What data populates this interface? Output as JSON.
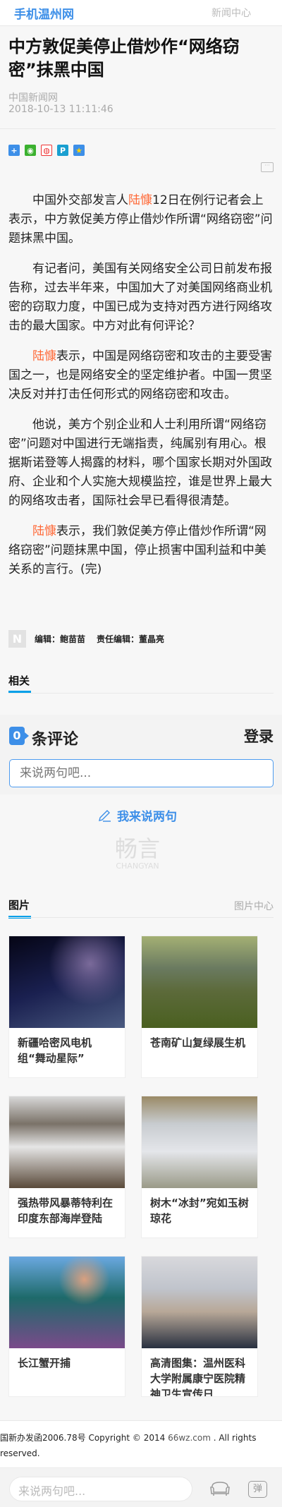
{
  "header": {
    "logo": "手机温州网",
    "nav": "新闻中心"
  },
  "article": {
    "title": "中方敦促美停止借炒作“网络窃密”抹黑中国",
    "source": "中国新闻网",
    "date": "2018-10-13 11:11:46",
    "share_icons": [
      "addthis-icon",
      "wechat-icon",
      "weibo-icon",
      "pengyou-icon",
      "qzone-icon"
    ],
    "highlight_color": "#ff6633",
    "paragraphs": [
      {
        "a": "中国外交部发言人",
        "h": "陆慷",
        "b": "12日在例行记者会上表示，中方敦促美方停止借炒作所谓“网络窃密”问题抹黑中国。"
      },
      {
        "a": "有记者问，美国有关网络安全公司日前发布报告称，过去半年来，中国加大了对美国网络商业机密的窃取力度，中国已成为支持对西方进行网络攻击的最大国家。中方对此有何评论？"
      },
      {
        "h": "陆慷",
        "b": "表示，中国是网络窃密和攻击的主要受害国之一，也是网络安全的坚定维护者。中国一贯坚决反对并打击任何形式的网络窃密和攻击。"
      },
      {
        "a": "他说，美方个别企业和人士利用所谓“网络窃密”问题对中国进行无端指责，纯属别有用心。根据斯诺登等人揭露的材料，哪个国家长期对外国政府、企业和个人实施大规模监控，谁是世界上最大的网络攻击者，国际社会早已看得很清楚。"
      },
      {
        "h": "陆慷",
        "b": "表示，我们敦促美方停止借炒作所谓“网络窃密”问题抹黑中国，停止损害中国利益和中美关系的言行。(完)"
      }
    ],
    "editor_badge": "N",
    "editor": "编辑：鲍苗苗",
    "chief_editor": "责任编辑：董晶亮"
  },
  "related": {
    "title": "相关"
  },
  "comments": {
    "count": "0",
    "label": "条评论",
    "login": "登录",
    "placeholder": "来说两句吧...",
    "say": "我来说两句",
    "brand_cn": "畅言",
    "brand_en": "CHANGYAN",
    "accent": "#3d8fe8"
  },
  "photos": {
    "title": "图片",
    "more": "图片中心",
    "items": [
      {
        "caption": "新疆哈密风电机组“舞动星际”"
      },
      {
        "caption": "苍南矿山复绿展生机"
      },
      {
        "caption": "强热带风暴蒂特利在印度东部海岸登陆"
      },
      {
        "caption": "树木“冰封”宛如玉树琼花"
      },
      {
        "caption": "长江蟹开捕"
      },
      {
        "caption": "高清图集：温州医科大学附属康宁医院精神卫生宣传日"
      }
    ]
  },
  "footer": {
    "text": "国新办发函2006.78号 Copyright © 2014  ",
    "link": "66wz.com",
    "tail": " . All rights reserved."
  },
  "bottombar": {
    "placeholder": "来说两句吧...",
    "danmu": "弹"
  }
}
